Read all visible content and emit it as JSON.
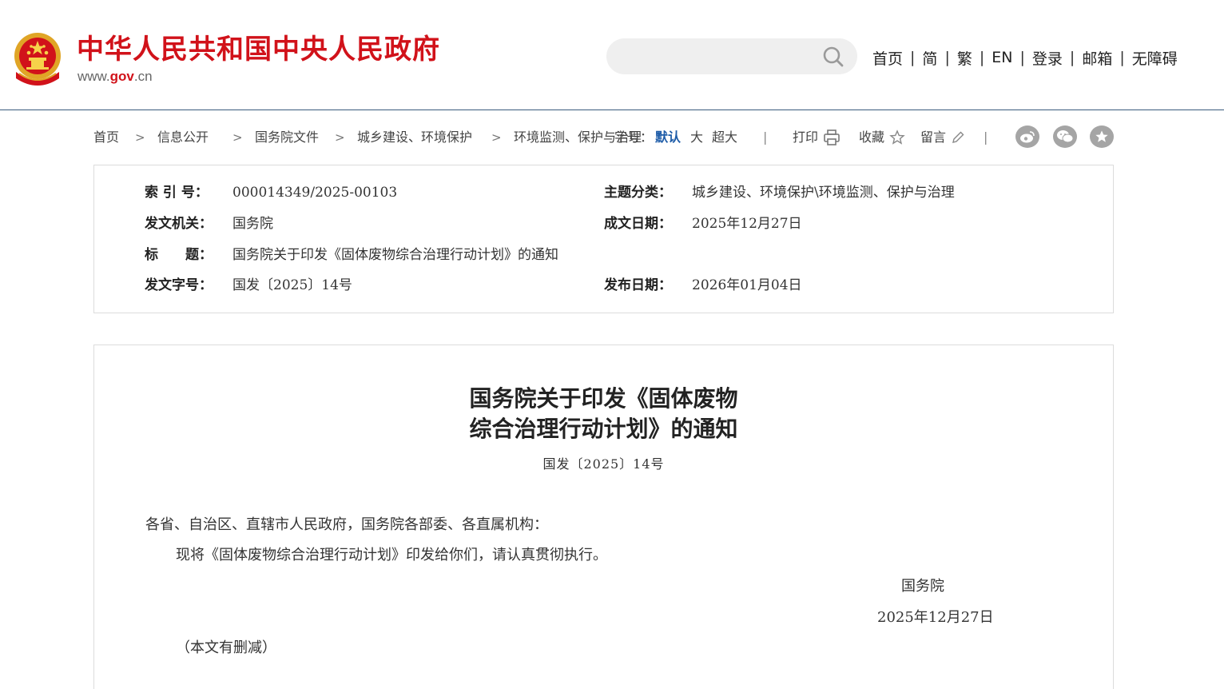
{
  "header": {
    "site_title": "中华人民共和国中央人民政府",
    "domain_prefix": "www.",
    "domain_main": "gov",
    "domain_suffix": ".cn",
    "search": {
      "placeholder": "",
      "icon": "search-icon"
    },
    "nav": [
      "首页",
      "简",
      "繁",
      "EN",
      "登录",
      "邮箱",
      "无障碍"
    ]
  },
  "breadcrumb": [
    "首页",
    "信息公开",
    "国务院文件",
    "城乡建设、环境保护",
    "环境监测、保护与治理"
  ],
  "toolbar": {
    "font_label": "字号：",
    "font_sizes": [
      "默认",
      "大",
      "超大"
    ],
    "print_label": "打印",
    "favorite_label": "收藏",
    "comment_label": "留言",
    "share_icons": [
      "weibo-icon",
      "wechat-icon",
      "favorite-star-icon"
    ]
  },
  "meta": {
    "index_label": "索 引 号：",
    "index_value": "000014349/2025-00103",
    "category_label": "主题分类：",
    "category_value": "城乡建设、环境保护\\环境监测、保护与治理",
    "issuer_label": "发文机关：",
    "issuer_value": "国务院",
    "written_date_label": "成文日期：",
    "written_date_value": "2025年12月27日",
    "title_label": "标　　题：",
    "title_value": "国务院关于印发《固体废物综合治理行动计划》的通知",
    "doc_no_label": "发文字号：",
    "doc_no_value": "国发〔2025〕14号",
    "publish_date_label": "发布日期：",
    "publish_date_value": "2026年01月04日"
  },
  "article": {
    "title_line1": "国务院关于印发《固体废物",
    "title_line2": "综合治理行动计划》的通知",
    "doc_number": "国发〔2025〕14号",
    "salutation": "各省、自治区、直辖市人民政府，国务院各部委、各直属机构：",
    "body": "现将《固体废物综合治理行动计划》印发给你们，请认真贯彻执行。",
    "signature": "国务院",
    "date": "2025年12月27日",
    "note": "（本文有删减）"
  },
  "colors": {
    "brand_red": "#d1121a",
    "accent_blue": "#1e5ca8",
    "divider": "#3a5b7c"
  }
}
